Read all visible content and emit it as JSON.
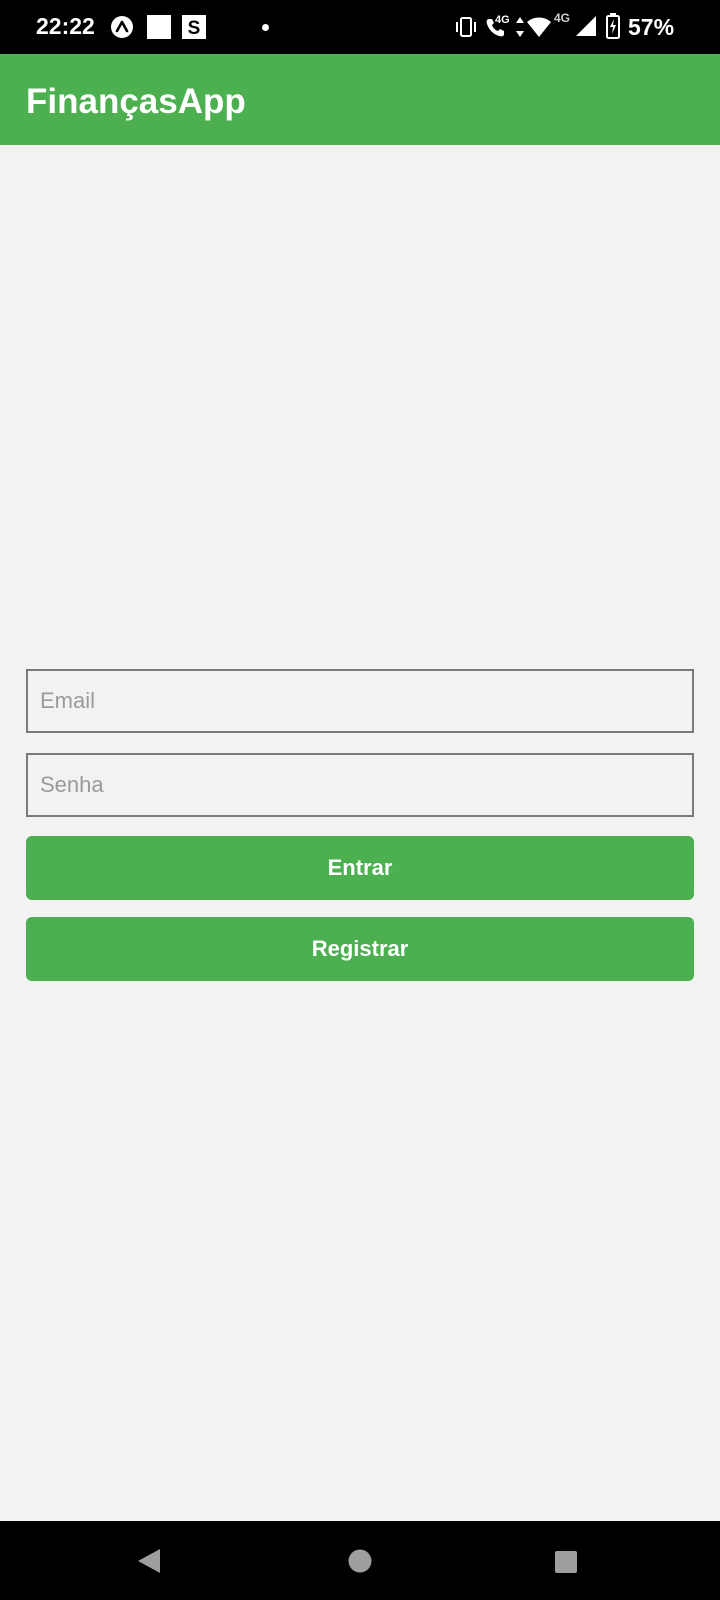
{
  "status_bar": {
    "time": "22:22",
    "network_label_1": "4G",
    "network_label_2": "4G",
    "battery_percent": "57%",
    "icons": [
      "app-a-icon",
      "white-square-icon",
      "s-app-icon",
      "notification-dot-icon",
      "vibrate-icon",
      "wifi-call-icon",
      "data-arrows-icon",
      "wifi-icon",
      "signal-icon",
      "battery-charging-icon"
    ]
  },
  "app_bar": {
    "title": "FinançasApp"
  },
  "login_form": {
    "email_placeholder": "Email",
    "password_placeholder": "Senha",
    "login_button_label": "Entrar",
    "register_button_label": "Registrar"
  },
  "nav_bar": {
    "icons": [
      "back-icon",
      "home-icon",
      "recents-icon"
    ]
  },
  "colors": {
    "primary": "#4caf50",
    "background": "#f2f2f2",
    "field_border": "#7a7a7a",
    "placeholder": "#9a9a9a"
  }
}
